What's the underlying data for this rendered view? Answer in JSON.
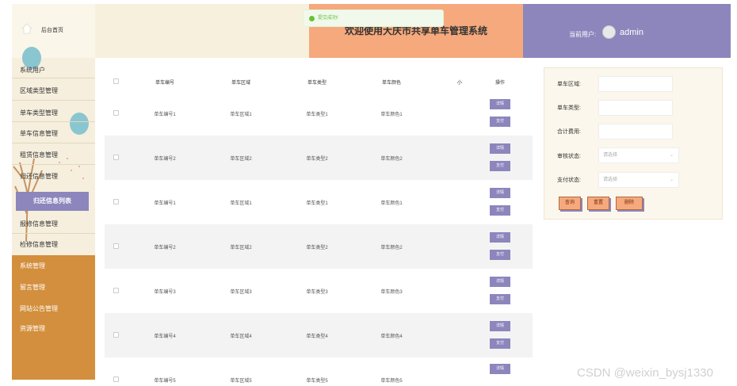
{
  "sidebar": {
    "home_label": "后台首页",
    "items": [
      {
        "label": "系统用户"
      },
      {
        "label": "区域类型管理"
      },
      {
        "label": "单车类型管理"
      },
      {
        "label": "单车信息管理"
      },
      {
        "label": "租赁信息管理"
      },
      {
        "label": "归还信息管理"
      },
      {
        "label": "归还信息列表"
      },
      {
        "label": "报修信息管理"
      },
      {
        "label": "检修信息管理"
      },
      {
        "label": "系统管理"
      },
      {
        "label": "留言管理"
      },
      {
        "label": "网站公告管理"
      },
      {
        "label": "资源管理"
      }
    ]
  },
  "header": {
    "title": "欢迎使用大庆市共享单车管理系统",
    "user_label": "当前用户:",
    "username": "admin",
    "toast": "提交成功!"
  },
  "table": {
    "headers": [
      "单车编号",
      "单车区域",
      "单车类型",
      "单车颜色",
      "小",
      "操作"
    ],
    "detail_label": "详情",
    "pay_label": "支付",
    "rows": [
      [
        "单车编号1",
        "单车区域1",
        "单车类型1",
        "单车颜色1"
      ],
      [
        "单车编号2",
        "单车区域2",
        "单车类型2",
        "单车颜色2"
      ],
      [
        "单车编号1",
        "单车区域1",
        "单车类型1",
        "单车颜色1"
      ],
      [
        "单车编号2",
        "单车区域2",
        "单车类型2",
        "单车颜色2"
      ],
      [
        "单车编号3",
        "单车区域3",
        "单车类型3",
        "单车颜色3"
      ],
      [
        "单车编号4",
        "单车区域4",
        "单车类型4",
        "单车颜色4"
      ],
      [
        "单车编号5",
        "单车区域5",
        "单车类型5",
        "单车颜色5"
      ]
    ]
  },
  "search": {
    "area_label": "单车区域:",
    "type_label": "单车类型:",
    "fee_label": "合计费用:",
    "audit_label": "审核状态:",
    "audit_placeholder": "请选择",
    "pay_label": "支付状态:",
    "pay_placeholder": "请选择",
    "query_button": "查询",
    "reset_button": "重置",
    "delete_button": "删除"
  },
  "watermark": "CSDN @weixin_bysj1330",
  "colors": {
    "accent_purple": "#8c86bd",
    "accent_orange": "#f6a97c",
    "sidebar_dark": "#d38f3d",
    "sidebar_light": "#f6efde"
  }
}
